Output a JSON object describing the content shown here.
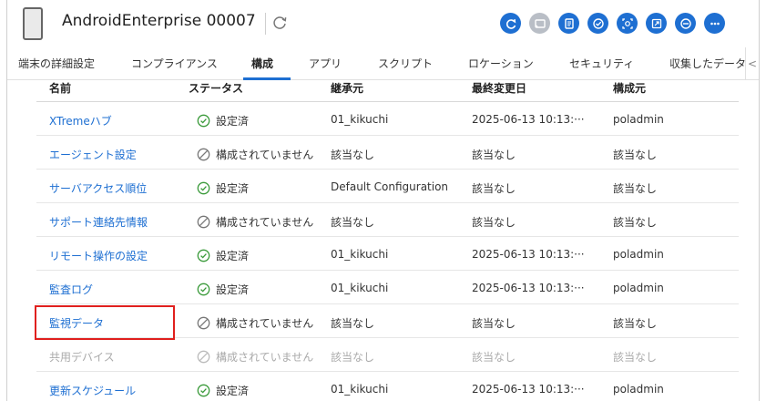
{
  "header": {
    "title": "AndroidEnterprise 00007",
    "device_icon": "phone-icon",
    "refresh_icon": "refresh-icon",
    "actions": [
      {
        "name": "sync-action-button",
        "icon": "sync-icon",
        "disabled": false
      },
      {
        "name": "cast-action-button",
        "icon": "cast-icon",
        "disabled": true
      },
      {
        "name": "document-action-button",
        "icon": "document-icon",
        "disabled": false
      },
      {
        "name": "check-action-button",
        "icon": "check-circle-icon",
        "disabled": false
      },
      {
        "name": "scan-action-button",
        "icon": "scan-icon",
        "disabled": false
      },
      {
        "name": "export-action-button",
        "icon": "export-icon",
        "disabled": false
      },
      {
        "name": "lock-action-button",
        "icon": "lock-icon",
        "disabled": false
      },
      {
        "name": "more-action-button",
        "icon": "more-icon",
        "disabled": false
      }
    ],
    "accent_color": "#1e6fd2",
    "disabled_color": "#b9bec6"
  },
  "tabs": [
    {
      "label": "端末の詳細設定",
      "active": false
    },
    {
      "label": "コンプライアンス",
      "active": false
    },
    {
      "label": "構成",
      "active": true
    },
    {
      "label": "アプリ",
      "active": false
    },
    {
      "label": "スクリプト",
      "active": false
    },
    {
      "label": "ロケーション",
      "active": false
    },
    {
      "label": "セキュリティ",
      "active": false
    },
    {
      "label": "収集したデータ",
      "active": false
    }
  ],
  "tab_nav_label": "<",
  "table": {
    "columns": [
      "名前",
      "ステータス",
      "継承元",
      "最終変更日",
      "構成元"
    ],
    "rows": [
      {
        "name": "XTremeハブ",
        "status": "設定済",
        "status_icon": "check-circle-icon",
        "source": "01_kikuchi",
        "date": "2025-06-13 10:13:···",
        "origin": "poladmin",
        "muted": false
      },
      {
        "name": "エージェント設定",
        "status": "構成されていません",
        "status_icon": "blocked-circle-icon",
        "source": "該当なし",
        "date": "該当なし",
        "origin": "該当なし",
        "muted": false
      },
      {
        "name": "サーバアクセス順位",
        "status": "設定済",
        "status_icon": "check-circle-icon",
        "source": "Default Configuration",
        "date": "該当なし",
        "origin": "該当なし",
        "muted": false
      },
      {
        "name": "サポート連絡先情報",
        "status": "構成されていません",
        "status_icon": "blocked-circle-icon",
        "source": "該当なし",
        "date": "該当なし",
        "origin": "該当なし",
        "muted": false
      },
      {
        "name": "リモート操作の設定",
        "status": "設定済",
        "status_icon": "check-circle-icon",
        "source": "01_kikuchi",
        "date": "2025-06-13 10:13:···",
        "origin": "poladmin",
        "muted": false
      },
      {
        "name": "監査ログ",
        "status": "設定済",
        "status_icon": "check-circle-icon",
        "source": "01_kikuchi",
        "date": "2025-06-13 10:13:···",
        "origin": "poladmin",
        "muted": false
      },
      {
        "name": "監視データ",
        "status": "構成されていません",
        "status_icon": "blocked-circle-icon",
        "source": "該当なし",
        "date": "該当なし",
        "origin": "該当なし",
        "muted": false
      },
      {
        "name": "共用デバイス",
        "status": "構成されていません",
        "status_icon": "blocked-circle-icon",
        "source": "該当なし",
        "date": "該当なし",
        "origin": "該当なし",
        "muted": true
      },
      {
        "name": "更新スケジュール",
        "status": "設定済",
        "status_icon": "check-circle-icon",
        "source": "01_kikuchi",
        "date": "2025-06-13 10:13:···",
        "origin": "poladmin",
        "muted": false
      }
    ]
  },
  "highlight_color": "#e0201e"
}
